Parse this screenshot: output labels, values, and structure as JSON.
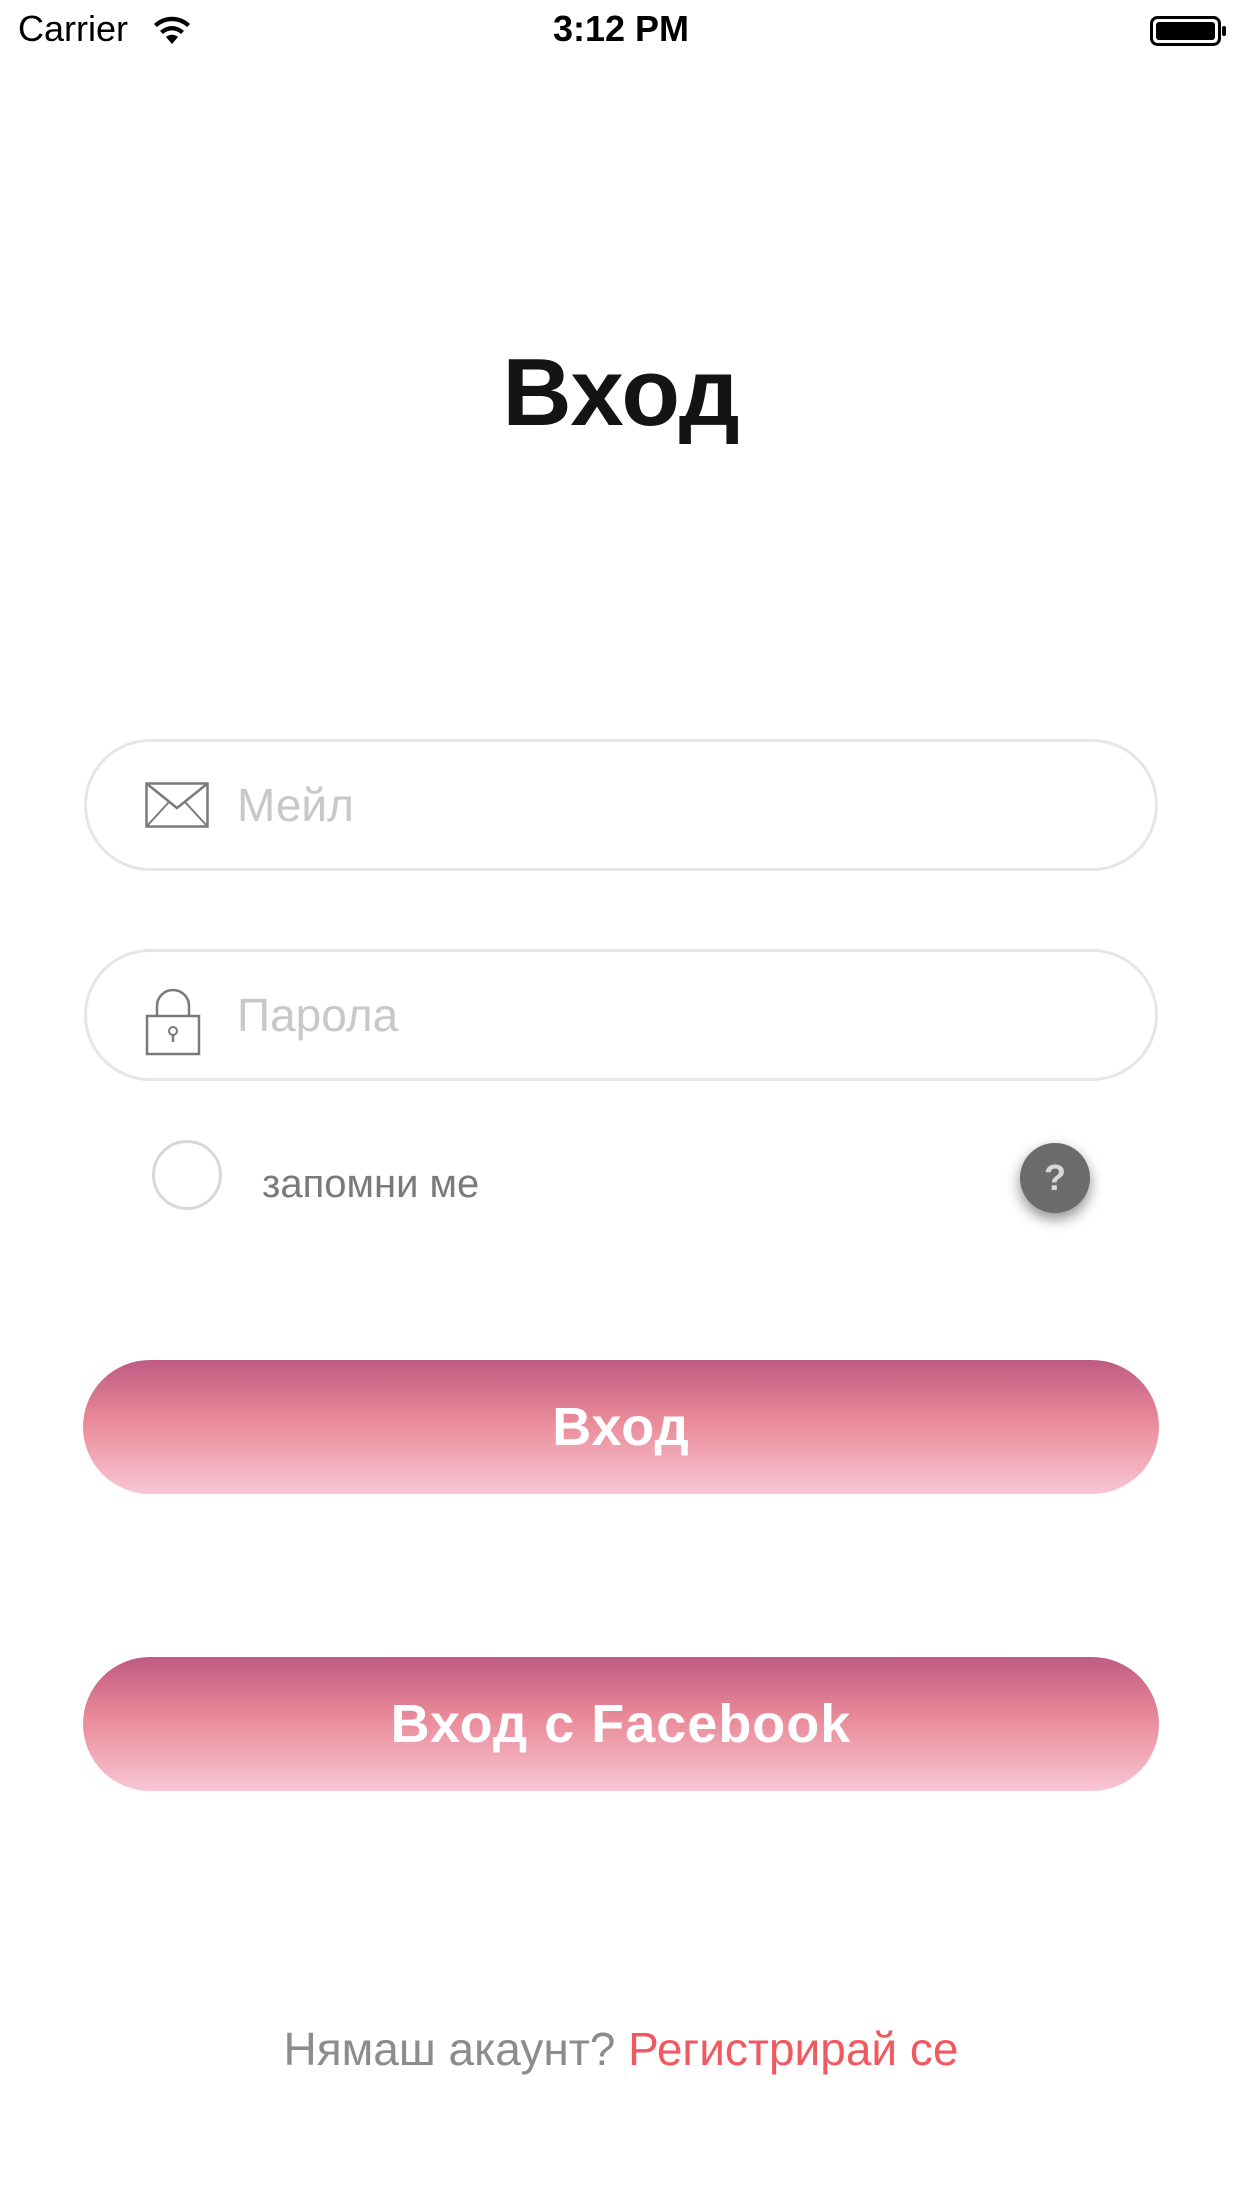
{
  "status_bar": {
    "carrier": "Carrier",
    "time": "3:12 PM",
    "wifi_icon": "wifi-icon",
    "battery_icon": "battery-full-icon"
  },
  "title": "Вход",
  "email": {
    "placeholder": "Мейл",
    "value": "",
    "icon": "envelope-icon"
  },
  "password": {
    "placeholder": "Парола",
    "value": "",
    "icon": "lock-icon"
  },
  "remember": {
    "label": "запомни ме",
    "checked": false
  },
  "help": {
    "label": "?"
  },
  "login_button": {
    "label": "Вход"
  },
  "facebook_button": {
    "label": "Вход с Facebook"
  },
  "signup": {
    "prompt": "Нямаш акаунт? ",
    "link": "Регистрирай се"
  },
  "colors": {
    "button_gradient_top": "#bf5b83",
    "button_gradient_mid": "#e98a98",
    "button_gradient_bottom": "#f8c6d4",
    "link": "#f0595f",
    "help_button": "#6b6b6b"
  }
}
